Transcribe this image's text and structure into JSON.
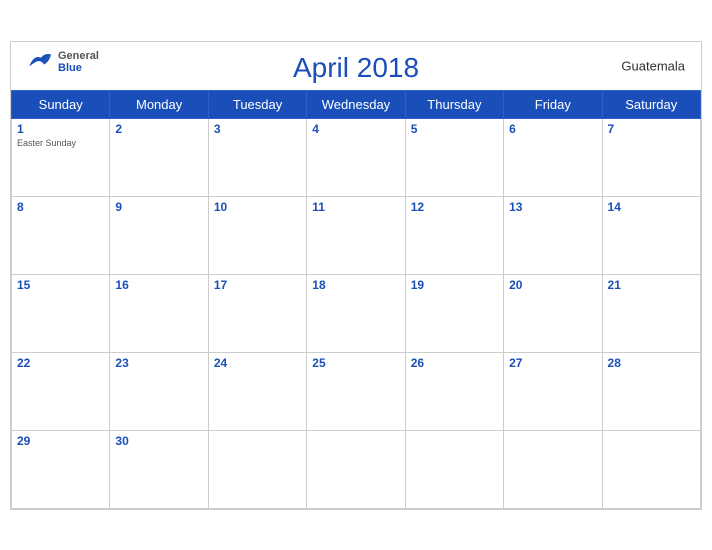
{
  "header": {
    "title": "April 2018",
    "country": "Guatemala",
    "logo": {
      "general": "General",
      "blue": "Blue"
    }
  },
  "weekdays": [
    "Sunday",
    "Monday",
    "Tuesday",
    "Wednesday",
    "Thursday",
    "Friday",
    "Saturday"
  ],
  "weeks": [
    [
      {
        "day": "1",
        "event": "Easter Sunday"
      },
      {
        "day": "2",
        "event": ""
      },
      {
        "day": "3",
        "event": ""
      },
      {
        "day": "4",
        "event": ""
      },
      {
        "day": "5",
        "event": ""
      },
      {
        "day": "6",
        "event": ""
      },
      {
        "day": "7",
        "event": ""
      }
    ],
    [
      {
        "day": "8",
        "event": ""
      },
      {
        "day": "9",
        "event": ""
      },
      {
        "day": "10",
        "event": ""
      },
      {
        "day": "11",
        "event": ""
      },
      {
        "day": "12",
        "event": ""
      },
      {
        "day": "13",
        "event": ""
      },
      {
        "day": "14",
        "event": ""
      }
    ],
    [
      {
        "day": "15",
        "event": ""
      },
      {
        "day": "16",
        "event": ""
      },
      {
        "day": "17",
        "event": ""
      },
      {
        "day": "18",
        "event": ""
      },
      {
        "day": "19",
        "event": ""
      },
      {
        "day": "20",
        "event": ""
      },
      {
        "day": "21",
        "event": ""
      }
    ],
    [
      {
        "day": "22",
        "event": ""
      },
      {
        "day": "23",
        "event": ""
      },
      {
        "day": "24",
        "event": ""
      },
      {
        "day": "25",
        "event": ""
      },
      {
        "day": "26",
        "event": ""
      },
      {
        "day": "27",
        "event": ""
      },
      {
        "day": "28",
        "event": ""
      }
    ],
    [
      {
        "day": "29",
        "event": ""
      },
      {
        "day": "30",
        "event": ""
      },
      {
        "day": "",
        "event": ""
      },
      {
        "day": "",
        "event": ""
      },
      {
        "day": "",
        "event": ""
      },
      {
        "day": "",
        "event": ""
      },
      {
        "day": "",
        "event": ""
      }
    ]
  ],
  "colors": {
    "header_bg": "#1a4fba",
    "title_color": "#1a4fba",
    "day_number_color": "#1a4fba"
  }
}
